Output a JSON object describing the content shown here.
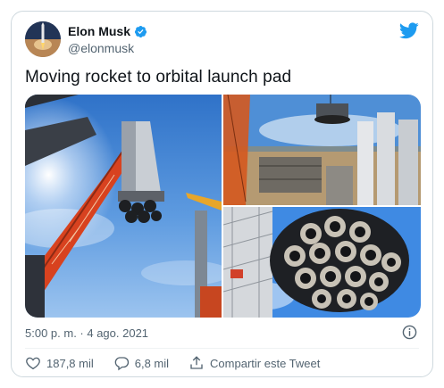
{
  "author": {
    "name": "Elon Musk",
    "handle": "@elonmusk"
  },
  "tweet": {
    "text": "Moving rocket to orbital launch pad",
    "timestamp": "5:00 p. m. · 4 ago. 2021"
  },
  "actions": {
    "likes": "187,8 mil",
    "replies": "6,8 mil",
    "share_label": "Compartir este Tweet"
  },
  "colors": {
    "brand_blue": "#1d9bf0",
    "text_secondary": "#536471",
    "border": "#cfd9de"
  },
  "icons": [
    "verified-badge-icon",
    "twitter-bird-icon",
    "info-icon",
    "heart-icon",
    "reply-icon",
    "share-icon"
  ]
}
